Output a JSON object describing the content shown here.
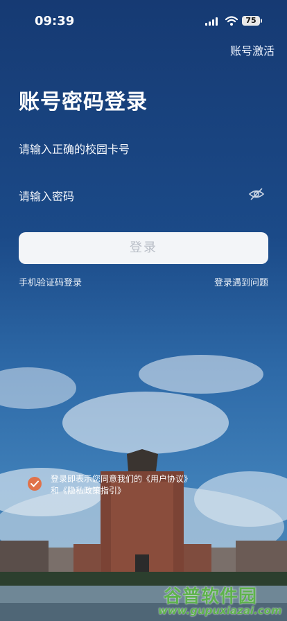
{
  "status": {
    "time": "09:39",
    "battery": "75"
  },
  "header": {
    "activate_label": "账号激活"
  },
  "main": {
    "title": "账号密码登录",
    "card_placeholder": "请输入正确的校园卡号",
    "password_placeholder": "请输入密码",
    "login_label": "登录",
    "sms_login": "手机验证码登录",
    "login_problem": "登录遇到问题"
  },
  "agreement": {
    "text": "登录即表示您同意我们的《用户协议》和《隐私政策指引》",
    "checked": true
  },
  "watermark": {
    "title": "谷普软件园",
    "url": "www.gupuxiazai.com"
  },
  "colors": {
    "accent_check": "#e0724a",
    "button_bg": "#f3f5f8",
    "button_text": "#b9bec7",
    "watermark": "#5eb24d"
  }
}
